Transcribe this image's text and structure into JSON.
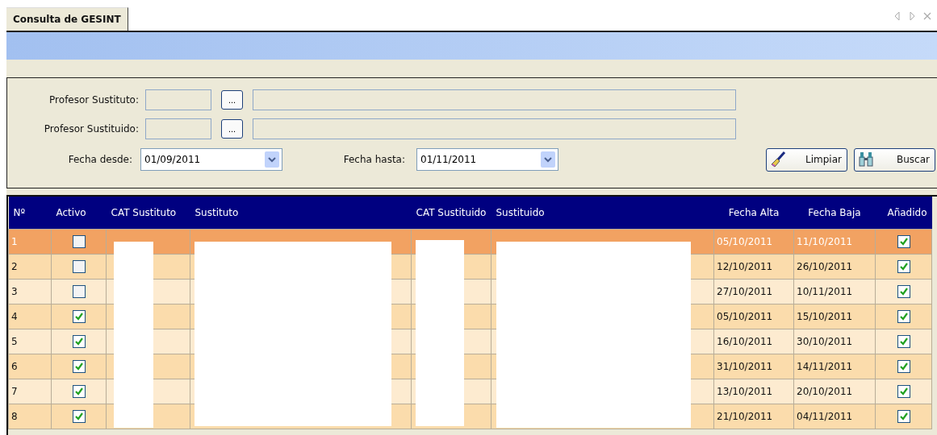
{
  "tab": {
    "title": "Consulta de GESINT",
    "selected": true
  },
  "filters": {
    "lookups": [
      {
        "label": "Profesor Sustituto:",
        "button": "..."
      },
      {
        "label": "Profesor Sustituido:",
        "button": "..."
      }
    ],
    "dates": [
      {
        "label": "Fecha desde:",
        "value": "01/09/2011"
      },
      {
        "label": "Fecha hasta:",
        "value": "01/11/2011"
      }
    ],
    "buttons": [
      {
        "label": "Limpiar",
        "kind": "brush"
      },
      {
        "label": "Buscar",
        "kind": "binoculars"
      }
    ]
  },
  "table": {
    "columns": [
      "Nº",
      "Activo",
      "CAT Sustituto",
      "Sustituto",
      "CAT Sustituido",
      "Sustituido",
      "Fecha Alta",
      "Fecha Baja",
      "Añadido"
    ],
    "rows": [
      {
        "n": "1",
        "activo": false,
        "fecha_alta": "05/10/2011",
        "fecha_baja": "11/10/2011",
        "anadido": true,
        "selected": true
      },
      {
        "n": "2",
        "activo": false,
        "fecha_alta": "12/10/2011",
        "fecha_baja": "26/10/2011",
        "anadido": true,
        "selected": false
      },
      {
        "n": "3",
        "activo": false,
        "fecha_alta": "27/10/2011",
        "fecha_baja": "10/11/2011",
        "anadido": true,
        "selected": false
      },
      {
        "n": "4",
        "activo": true,
        "fecha_alta": "05/10/2011",
        "fecha_baja": "15/10/2011",
        "anadido": true,
        "selected": false
      },
      {
        "n": "5",
        "activo": true,
        "fecha_alta": "16/10/2011",
        "fecha_baja": "30/10/2011",
        "anadido": true,
        "selected": false
      },
      {
        "n": "6",
        "activo": true,
        "fecha_alta": "31/10/2011",
        "fecha_baja": "14/11/2011",
        "anadido": true,
        "selected": false
      },
      {
        "n": "7",
        "activo": true,
        "fecha_alta": "13/10/2011",
        "fecha_baja": "20/10/2011",
        "anadido": true,
        "selected": false
      },
      {
        "n": "8",
        "activo": true,
        "fecha_alta": "21/10/2011",
        "fecha_baja": "04/11/2011",
        "anadido": true,
        "selected": false
      }
    ]
  }
}
